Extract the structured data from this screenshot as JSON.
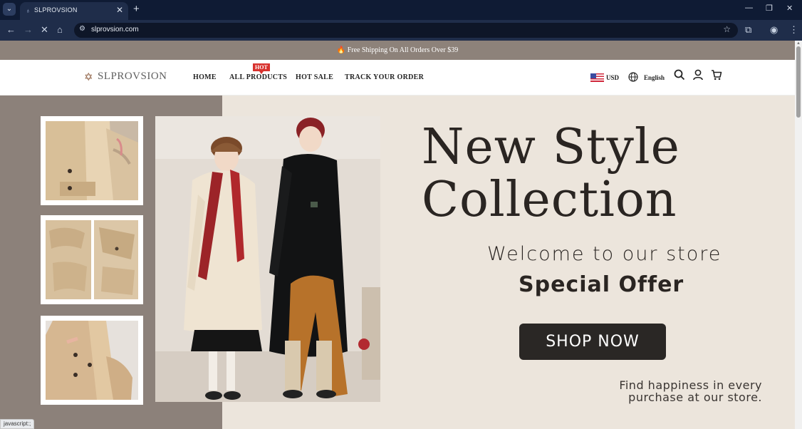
{
  "browser": {
    "tab_title": "SLPROVSION",
    "url": "slprovsion.com",
    "status_text": "javascript:;"
  },
  "announcement": {
    "text": "Free Shipping On All Orders Over $39"
  },
  "header": {
    "logo_text": "SLPROVSION",
    "nav": {
      "home": "HOME",
      "all_products": "ALL PRODUCTS",
      "hot_sale": "HOT SALE",
      "track": "TRACK YOUR ORDER"
    },
    "hot_badge": "HOT",
    "currency": "USD",
    "language": "English"
  },
  "hero": {
    "headline_line1": "New Style",
    "headline_line2": "Collection",
    "welcome": "Welcome to our store",
    "special": "Special Offer",
    "cta": "SHOP NOW",
    "tagline_line1": "Find happiness in every",
    "tagline_line2": "purchase at our store."
  },
  "colors": {
    "announcement_bg": "#8d827a",
    "hero_bg": "#ece5dc",
    "hero_left_bg": "#8c817a",
    "cta_bg": "#2a2725",
    "hot_badge": "#d8322e"
  }
}
